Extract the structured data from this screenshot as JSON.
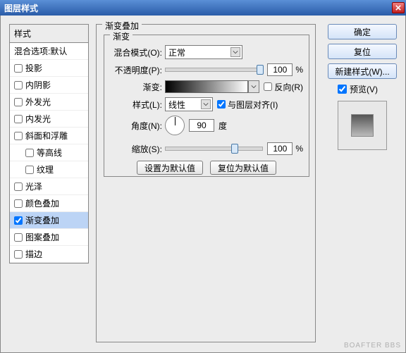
{
  "title": "图层样式",
  "left": {
    "header": "样式",
    "blend_options": "混合选项:默认",
    "items": [
      {
        "label": "投影",
        "checked": false,
        "indent": false
      },
      {
        "label": "内阴影",
        "checked": false,
        "indent": false
      },
      {
        "label": "外发光",
        "checked": false,
        "indent": false
      },
      {
        "label": "内发光",
        "checked": false,
        "indent": false
      },
      {
        "label": "斜面和浮雕",
        "checked": false,
        "indent": false
      },
      {
        "label": "等高线",
        "checked": false,
        "indent": true
      },
      {
        "label": "纹理",
        "checked": false,
        "indent": true
      },
      {
        "label": "光泽",
        "checked": false,
        "indent": false
      },
      {
        "label": "颜色叠加",
        "checked": false,
        "indent": false
      },
      {
        "label": "渐变叠加",
        "checked": true,
        "indent": false,
        "selected": true
      },
      {
        "label": "图案叠加",
        "checked": false,
        "indent": false
      },
      {
        "label": "描边",
        "checked": false,
        "indent": false
      }
    ]
  },
  "mid": {
    "group_title": "渐变叠加",
    "inner_title": "渐变",
    "blend_mode": {
      "label": "混合模式(O):",
      "value": "正常"
    },
    "opacity": {
      "label": "不透明度(P):",
      "value": "100",
      "unit": "%"
    },
    "gradient": {
      "label": "渐变:",
      "reverse_label": "反向(R)",
      "reverse_checked": false
    },
    "style": {
      "label": "样式(L):",
      "value": "线性",
      "align_label": "与图层对齐(I)",
      "align_checked": true
    },
    "angle": {
      "label": "角度(N):",
      "value": "90",
      "unit": "度"
    },
    "scale": {
      "label": "缩放(S):",
      "value": "100",
      "unit": "%"
    },
    "set_default": "设置为默认值",
    "reset_default": "复位为默认值"
  },
  "right": {
    "ok": "确定",
    "cancel": "复位",
    "new_style": "新建样式(W)...",
    "preview_label": "预览(V)",
    "preview_checked": true
  },
  "watermark": "BOAFTER BBS"
}
